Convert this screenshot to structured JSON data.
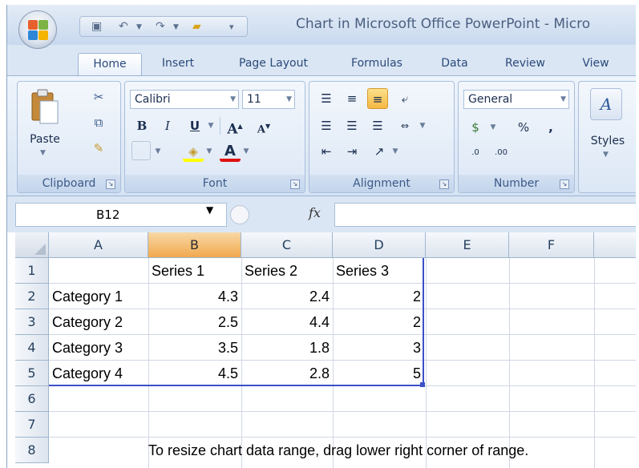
{
  "window": {
    "title": "Chart in Microsoft Office PowerPoint - Micro"
  },
  "tabs": [
    "Home",
    "Insert",
    "Page Layout",
    "Formulas",
    "Data",
    "Review",
    "View"
  ],
  "ribbon": {
    "clipboard": {
      "label": "Clipboard",
      "paste_label": "Paste"
    },
    "font": {
      "label": "Font",
      "font_name": "Calibri",
      "font_size": "11"
    },
    "alignment": {
      "label": "Alignment"
    },
    "number": {
      "label": "Number",
      "format": "General"
    },
    "styles": {
      "label": "Styles"
    }
  },
  "formula_bar": {
    "name_box": "B12",
    "fx_label": "fx",
    "formula": ""
  },
  "sheet": {
    "columns": [
      "A",
      "B",
      "C",
      "D",
      "E",
      "F"
    ],
    "rows": [
      "1",
      "2",
      "3",
      "4",
      "5",
      "6",
      "7",
      "8"
    ],
    "selected_column": "B",
    "headers": [
      "Series 1",
      "Series 2",
      "Series 3"
    ],
    "data": [
      {
        "category": "Category 1",
        "s1": "4.3",
        "s2": "2.4",
        "s3": "2"
      },
      {
        "category": "Category 2",
        "s1": "2.5",
        "s2": "4.4",
        "s3": "2"
      },
      {
        "category": "Category 3",
        "s1": "3.5",
        "s2": "1.8",
        "s3": "3"
      },
      {
        "category": "Category 4",
        "s1": "4.5",
        "s2": "2.8",
        "s3": "5"
      }
    ],
    "note": "To resize chart data range, drag lower right corner of range."
  },
  "colors": {
    "selection_border": "#3a50c8",
    "selected_header": "#f1a94e"
  }
}
